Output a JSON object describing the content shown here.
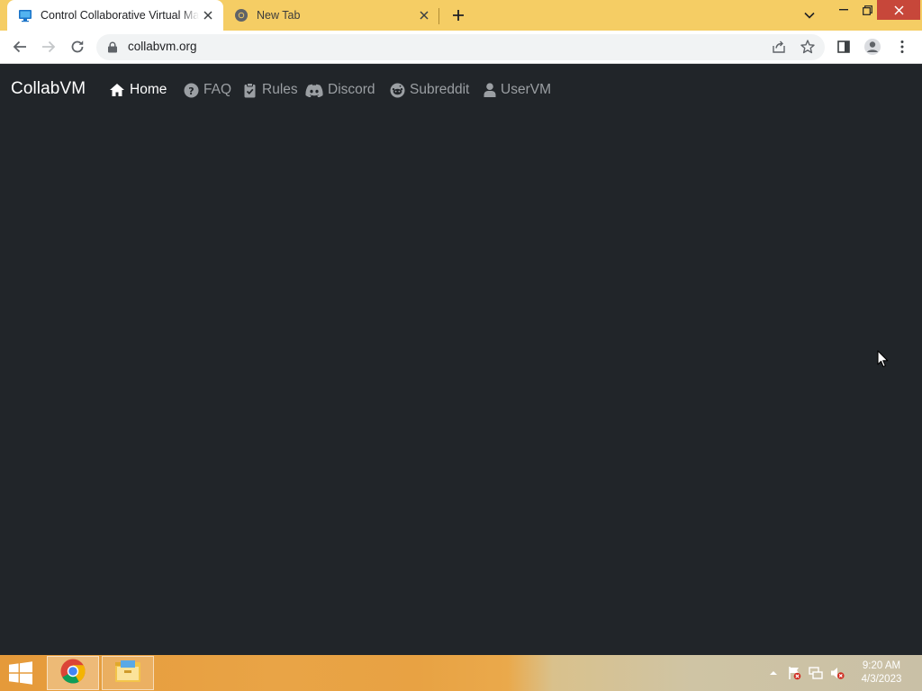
{
  "browser": {
    "tabs": [
      {
        "title": "Control Collaborative Virtual Machines",
        "favicon": "monitor-icon",
        "active": true
      },
      {
        "title": "New Tab",
        "favicon": "chrome-icon",
        "active": false
      }
    ],
    "url": "collabvm.org"
  },
  "site": {
    "brand": "CollabVM",
    "nav": [
      {
        "label": "Home",
        "icon": "home-icon",
        "active": true
      },
      {
        "label": "FAQ",
        "icon": "question-circle-icon",
        "active": false
      },
      {
        "label": "Rules",
        "icon": "clipboard-check-icon",
        "active": false
      },
      {
        "label": "Discord",
        "icon": "discord-icon",
        "active": false
      },
      {
        "label": "Subreddit",
        "icon": "reddit-icon",
        "active": false
      },
      {
        "label": "UserVM",
        "icon": "user-icon",
        "active": false
      }
    ]
  },
  "taskbar": {
    "apps": [
      "chrome-icon",
      "file-explorer-icon"
    ],
    "tray": [
      "show-hidden-icons-chevron",
      "action-center-flag-icon",
      "network-icon",
      "volume-muted-icon"
    ],
    "time": "9:20 AM",
    "date": "4/3/2023"
  },
  "colors": {
    "tabstrip": "#f5cd64",
    "page_background": "#212529",
    "nav_active": "#ffffff",
    "nav_inactive": "#9b9fa3",
    "close_button": "#c7473a"
  }
}
